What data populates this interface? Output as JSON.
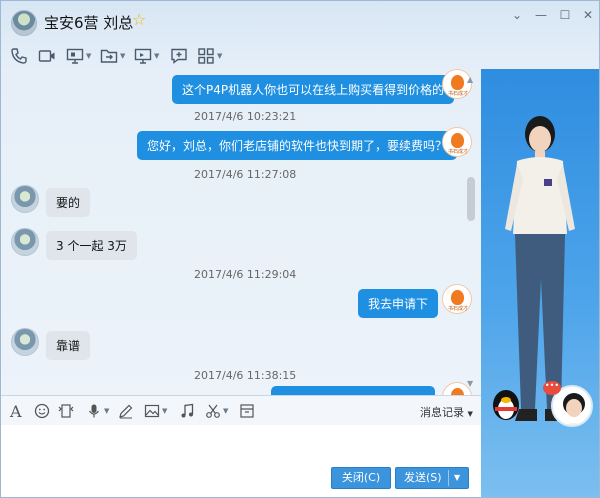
{
  "window": {
    "contact_name": "宝安6营 刘总",
    "star_icon": "star-icon",
    "controls": [
      "chevron-down-icon",
      "minimize-icon",
      "maximize-icon",
      "close-icon"
    ]
  },
  "toolbar": {
    "tools": [
      "phone-icon",
      "video-icon",
      "screen-share-icon",
      "file-transfer-icon",
      "remote-desktop-icon",
      "add-chat-icon",
      "apps-grid-icon"
    ]
  },
  "chat": {
    "messages": [
      {
        "side": "right",
        "text": "这个P4P机器人你也可以在线上购买看得到价格的"
      },
      {
        "time": "2017/4/6 10:23:21"
      },
      {
        "side": "right",
        "text": "您好，刘总，你们老店铺的软件也快到期了，要续费吗？"
      },
      {
        "time": "2017/4/6 11:27:08"
      },
      {
        "side": "left",
        "text": "要的"
      },
      {
        "side": "left",
        "text": "3 个一起  3万"
      },
      {
        "time": "2017/4/6 11:29:04"
      },
      {
        "side": "right",
        "text": "我去申请下"
      },
      {
        "side": "left",
        "text": "靠谱"
      },
      {
        "time": "2017/4/6 11:38:15"
      }
    ],
    "sender_logo_text": "书石成才",
    "accent_blue": "#1e8fe1",
    "bubble_gray": "#dfe5ea"
  },
  "input": {
    "tools": [
      "font-icon",
      "emoji-icon",
      "gif-icon",
      "mic-icon",
      "pen-icon",
      "image-icon",
      "music-icon",
      "scissors-icon",
      "archive-icon"
    ],
    "history_label": "消息记录"
  },
  "buttons": {
    "close_label": "关闭(C)",
    "send_label": "发送(S)"
  }
}
